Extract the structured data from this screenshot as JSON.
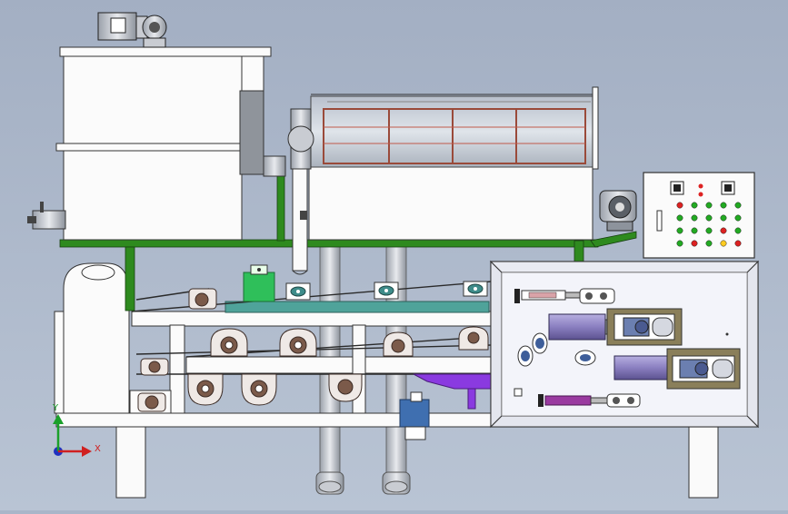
{
  "triad": {
    "x_label": "X",
    "y_label": "Y"
  },
  "colors": {
    "frame_green": "#2e8a1e",
    "cylinder_purple": "#8a7fc0",
    "magenta_cylinder": "#9a3aa0",
    "violet_beam": "#8a3ae0",
    "teal_base": "#4fa39a",
    "roller_brown": "#7b5a4a",
    "drum_copper": "#9a4a3a",
    "panel_fill": "#f3f4fa"
  },
  "icons": [
    "motor-gearbox-icon",
    "electric-motor-icon",
    "control-panel-icon",
    "coordinate-triad-icon"
  ]
}
